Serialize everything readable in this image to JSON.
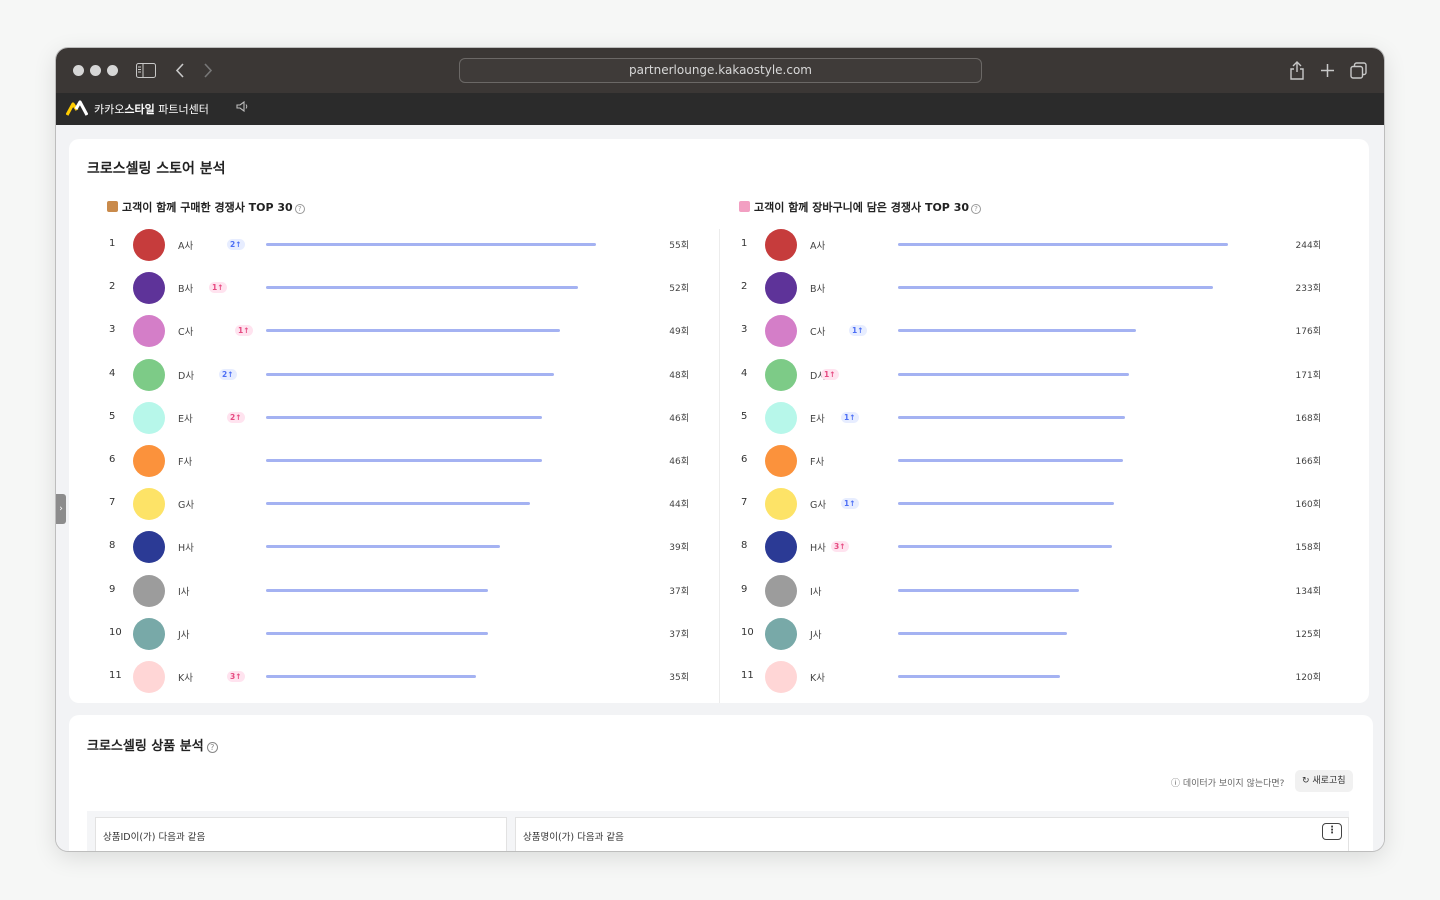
{
  "browser": {
    "url": "partnerlounge.kakaostyle.com"
  },
  "app": {
    "brand_prefix": "카카오",
    "brand_bold": "스타일",
    "brand_suffix": " 파트너센터"
  },
  "store_analysis": {
    "title": "크로스셀링 스토어 분석",
    "left": {
      "title": "고객이 함께 구매한 경쟁사 TOP 30",
      "icon": "money-bag-icon",
      "items": [
        {
          "rank": "1",
          "name": "A사",
          "badge": "2↑",
          "dir": "up",
          "value": 55,
          "label": "55회",
          "color": "#c63c3c"
        },
        {
          "rank": "2",
          "name": "B사",
          "badge": "1↑",
          "dir": "down",
          "value": 52,
          "label": "52회",
          "color": "#5e3399"
        },
        {
          "rank": "3",
          "name": "C사",
          "badge": "1↑",
          "dir": "down",
          "value": 49,
          "label": "49회",
          "color": "#d47ec8"
        },
        {
          "rank": "4",
          "name": "D사",
          "badge": "2↑",
          "dir": "up",
          "value": 48,
          "label": "48회",
          "color": "#7dcb87"
        },
        {
          "rank": "5",
          "name": "E사",
          "badge": "2↑",
          "dir": "down",
          "value": 46,
          "label": "46회",
          "color": "#b7f7ea"
        },
        {
          "rank": "6",
          "name": "F사",
          "badge": "",
          "dir": "",
          "value": 46,
          "label": "46회",
          "color": "#fb923c"
        },
        {
          "rank": "7",
          "name": "G사",
          "badge": "",
          "dir": "",
          "value": 44,
          "label": "44회",
          "color": "#fde367"
        },
        {
          "rank": "8",
          "name": "H사",
          "badge": "",
          "dir": "",
          "value": 39,
          "label": "39회",
          "color": "#2b3a95"
        },
        {
          "rank": "9",
          "name": "I사",
          "badge": "",
          "dir": "",
          "value": 37,
          "label": "37회",
          "color": "#9c9c9c"
        },
        {
          "rank": "10",
          "name": "J사",
          "badge": "",
          "dir": "",
          "value": 37,
          "label": "37회",
          "color": "#78a9a8"
        },
        {
          "rank": "11",
          "name": "K사",
          "badge": "3↑",
          "dir": "down",
          "value": 35,
          "label": "35회",
          "color": "#ffd6d6"
        }
      ]
    },
    "right": {
      "title": "고객이 함께 장바구니에 담은 경쟁사 TOP 30",
      "icon": "shopping-bag-icon",
      "items": [
        {
          "rank": "1",
          "name": "A사",
          "badge": "",
          "dir": "",
          "value": 244,
          "label": "244회",
          "color": "#c63c3c"
        },
        {
          "rank": "2",
          "name": "B사",
          "badge": "",
          "dir": "",
          "value": 233,
          "label": "233회",
          "color": "#5e3399"
        },
        {
          "rank": "3",
          "name": "C사",
          "badge": "1↑",
          "dir": "up",
          "value": 176,
          "label": "176회",
          "color": "#d47ec8"
        },
        {
          "rank": "4",
          "name": "D사",
          "badge": "1↑",
          "dir": "down",
          "value": 171,
          "label": "171회",
          "color": "#7dcb87"
        },
        {
          "rank": "5",
          "name": "E사",
          "badge": "1↑",
          "dir": "up",
          "value": 168,
          "label": "168회",
          "color": "#b7f7ea"
        },
        {
          "rank": "6",
          "name": "F사",
          "badge": "",
          "dir": "",
          "value": 166,
          "label": "166회",
          "color": "#fb923c"
        },
        {
          "rank": "7",
          "name": "G사",
          "badge": "1↑",
          "dir": "up",
          "value": 160,
          "label": "160회",
          "color": "#fde367"
        },
        {
          "rank": "8",
          "name": "H사",
          "badge": "3↑",
          "dir": "down",
          "value": 158,
          "label": "158회",
          "color": "#2b3a95"
        },
        {
          "rank": "9",
          "name": "I사",
          "badge": "",
          "dir": "",
          "value": 134,
          "label": "134회",
          "color": "#9c9c9c"
        },
        {
          "rank": "10",
          "name": "J사",
          "badge": "",
          "dir": "",
          "value": 125,
          "label": "125회",
          "color": "#78a9a8"
        },
        {
          "rank": "11",
          "name": "K사",
          "badge": "",
          "dir": "",
          "value": 120,
          "label": "120회",
          "color": "#ffd6d6"
        }
      ]
    }
  },
  "product_analysis": {
    "title": "크로스셀링 상품 분석",
    "nodata_text": "ⓘ 데이터가 보이지 않는다면?",
    "refresh_label": "↻ 새로고침",
    "filters": [
      "상품ID이(가) 다음과 같음",
      "상품명이(가) 다음과 같음"
    ]
  },
  "colors": {
    "bar": "#a4b2f2",
    "badge_up_bg": "#e7edff",
    "badge_up_text": "#4c6ef5",
    "badge_down_bg": "#ffe3ef",
    "badge_down_text": "#e64980"
  }
}
